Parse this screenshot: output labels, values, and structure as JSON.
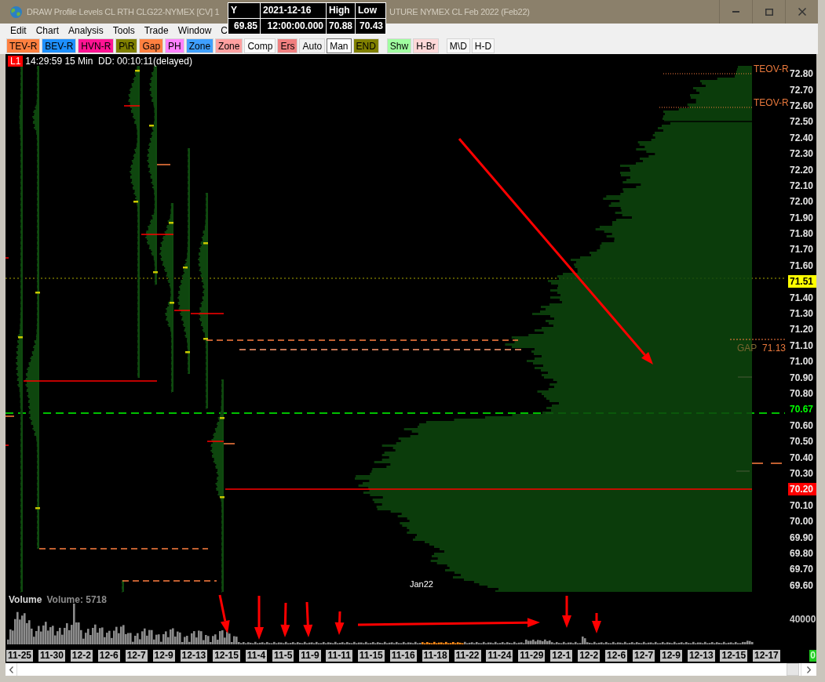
{
  "window": {
    "title_parts": [
      "DRAW Profile Levels CL RTH CLG22-NYMEX [CV] 1",
      "UTURE NYMEX CL Feb 2022 (Feb22)"
    ]
  },
  "data_tooltip": {
    "rows": [
      [
        "Y",
        "2021-12-16",
        "High",
        "Low"
      ],
      [
        "69.85",
        "12:00:00.000",
        "70.88",
        "70.43"
      ]
    ]
  },
  "menu": [
    "Edit",
    "Chart",
    "Analysis",
    "Tools",
    "Trade",
    "Window",
    "C"
  ],
  "toolbar": {
    "groups": [
      {
        "buttons": [
          {
            "label": "TEV-R",
            "color": "#ff8040",
            "selected": false
          },
          {
            "label": "BEV-R",
            "color": "#1e90ff",
            "selected": false
          },
          {
            "label": "HVN-R",
            "color": "#ff1493",
            "selected": false
          },
          {
            "label": "P\\R",
            "color": "#808000",
            "selected": false
          },
          {
            "label": "Gap",
            "color": "#ff8040",
            "selected": false
          },
          {
            "label": "PH",
            "color": "#ff80ff",
            "selected": false
          },
          {
            "label": "Zone",
            "color": "#3fa0ff",
            "selected": false
          },
          {
            "label": "Zone",
            "color": "#ffa0a0",
            "selected": false
          },
          {
            "label": "Comp",
            "color": "#fbfbfb",
            "selected": false
          },
          {
            "label": "Ers",
            "color": "#f08080",
            "selected": false
          },
          {
            "label": "Auto",
            "color": "#f0f0f0",
            "selected": false
          },
          {
            "label": "Man",
            "color": "#ffffff",
            "selected": true
          },
          {
            "label": "END",
            "color": "#808000",
            "selected": false
          }
        ]
      },
      {
        "buttons": [
          {
            "label": "Shw",
            "color": "#a0ffa0",
            "selected": false
          },
          {
            "label": "H-Br",
            "color": "#ffd8d8",
            "selected": false
          }
        ]
      },
      {
        "buttons": [
          {
            "label": "M\\D",
            "color": "#f8f8f8",
            "selected": false
          },
          {
            "label": "H-D",
            "color": "#f8f8f8",
            "selected": false
          }
        ]
      }
    ]
  },
  "chart": {
    "badge": "L1",
    "status": "14:29:59 15 Min  DD: 00:10:11(delayed)",
    "level_labels": [
      "TEOV-R",
      "TEOV-R"
    ],
    "gap_label": "GAP",
    "gap_price": "71.13",
    "month_label": "Jan22",
    "price_axis": [
      {
        "label": "72.80",
        "kind": "plain"
      },
      {
        "label": "72.70",
        "kind": "plain"
      },
      {
        "label": "72.60",
        "kind": "plain"
      },
      {
        "label": "72.50",
        "kind": "plain"
      },
      {
        "label": "72.40",
        "kind": "plain"
      },
      {
        "label": "72.30",
        "kind": "plain"
      },
      {
        "label": "72.20",
        "kind": "plain"
      },
      {
        "label": "72.10",
        "kind": "plain"
      },
      {
        "label": "72.00",
        "kind": "plain"
      },
      {
        "label": "71.90",
        "kind": "plain"
      },
      {
        "label": "71.80",
        "kind": "plain"
      },
      {
        "label": "71.70",
        "kind": "plain"
      },
      {
        "label": "71.60",
        "kind": "plain"
      },
      {
        "label": "71.51",
        "kind": "filled",
        "color": "#ffff00"
      },
      {
        "label": "71.40",
        "kind": "plain"
      },
      {
        "label": "71.30",
        "kind": "plain"
      },
      {
        "label": "71.20",
        "kind": "plain"
      },
      {
        "label": "71.10",
        "kind": "plain"
      },
      {
        "label": "71.00",
        "kind": "plain"
      },
      {
        "label": "70.90",
        "kind": "plain"
      },
      {
        "label": "70.80",
        "kind": "plain"
      },
      {
        "label": "70.67",
        "kind": "colored",
        "color": "#00ff00"
      },
      {
        "label": "70.60",
        "kind": "plain"
      },
      {
        "label": "70.50",
        "kind": "plain"
      },
      {
        "label": "70.40",
        "kind": "plain"
      },
      {
        "label": "70.30",
        "kind": "plain"
      },
      {
        "label": "70.20",
        "kind": "filled",
        "color": "#ff0000"
      },
      {
        "label": "70.10",
        "kind": "plain"
      },
      {
        "label": "70.00",
        "kind": "plain"
      },
      {
        "label": "69.90",
        "kind": "plain"
      },
      {
        "label": "69.80",
        "kind": "plain"
      },
      {
        "label": "69.70",
        "kind": "plain"
      },
      {
        "label": "69.60",
        "kind": "plain"
      }
    ]
  },
  "volume": {
    "title": "Volume",
    "reading": "Volume: 5718",
    "axis_label": "40000"
  },
  "date_axis": {
    "labels": [
      "11-25",
      "11-30",
      "12-2",
      "12-6",
      "12-7",
      "12-9",
      "12-13",
      "12-15",
      "11-4",
      "11-5",
      "11-9",
      "11-11",
      "11-15",
      "11-16",
      "11-18",
      "11-22",
      "11-24",
      "11-29",
      "12-1",
      "12-2",
      "12-6",
      "12-7",
      "12-9",
      "12-13",
      "12-15",
      "12-17"
    ],
    "counter": "0"
  }
}
